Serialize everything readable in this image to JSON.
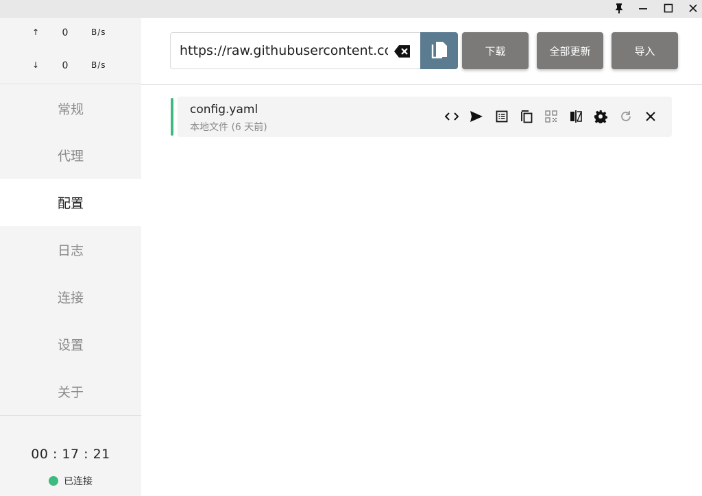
{
  "window": {
    "pin_icon": "pin-icon",
    "minimize_icon": "minimize-icon",
    "maximize_icon": "maximize-icon",
    "close_icon": "close-icon"
  },
  "speed": {
    "upload_arrow": "↑",
    "upload_value": "0",
    "upload_unit": "B/s",
    "download_arrow": "↓",
    "download_value": "0",
    "download_unit": "B/s"
  },
  "nav": {
    "items": [
      {
        "label": "常规"
      },
      {
        "label": "代理"
      },
      {
        "label": "配置"
      },
      {
        "label": "日志"
      },
      {
        "label": "连接"
      },
      {
        "label": "设置"
      },
      {
        "label": "关于"
      }
    ],
    "active_index": 2
  },
  "status": {
    "clock": "00 : 17 : 21",
    "connection": "已连接",
    "connection_color": "#3dba7e"
  },
  "toolbar": {
    "url_value": "https://raw.githubusercontent.com",
    "download_label": "下载",
    "update_all_label": "全部更新",
    "import_label": "导入",
    "paste_color": "#5b7b91",
    "button_color": "#7b7a79"
  },
  "profile": {
    "name": "config.yaml",
    "subtitle": "本地文件 (6 天前)",
    "accent_color": "#3dba7e",
    "actions": [
      "code-icon",
      "send-icon",
      "list-icon",
      "copy-icon",
      "qrcode-icon",
      "compare-icon",
      "settings-icon",
      "refresh-icon",
      "close-icon"
    ]
  }
}
